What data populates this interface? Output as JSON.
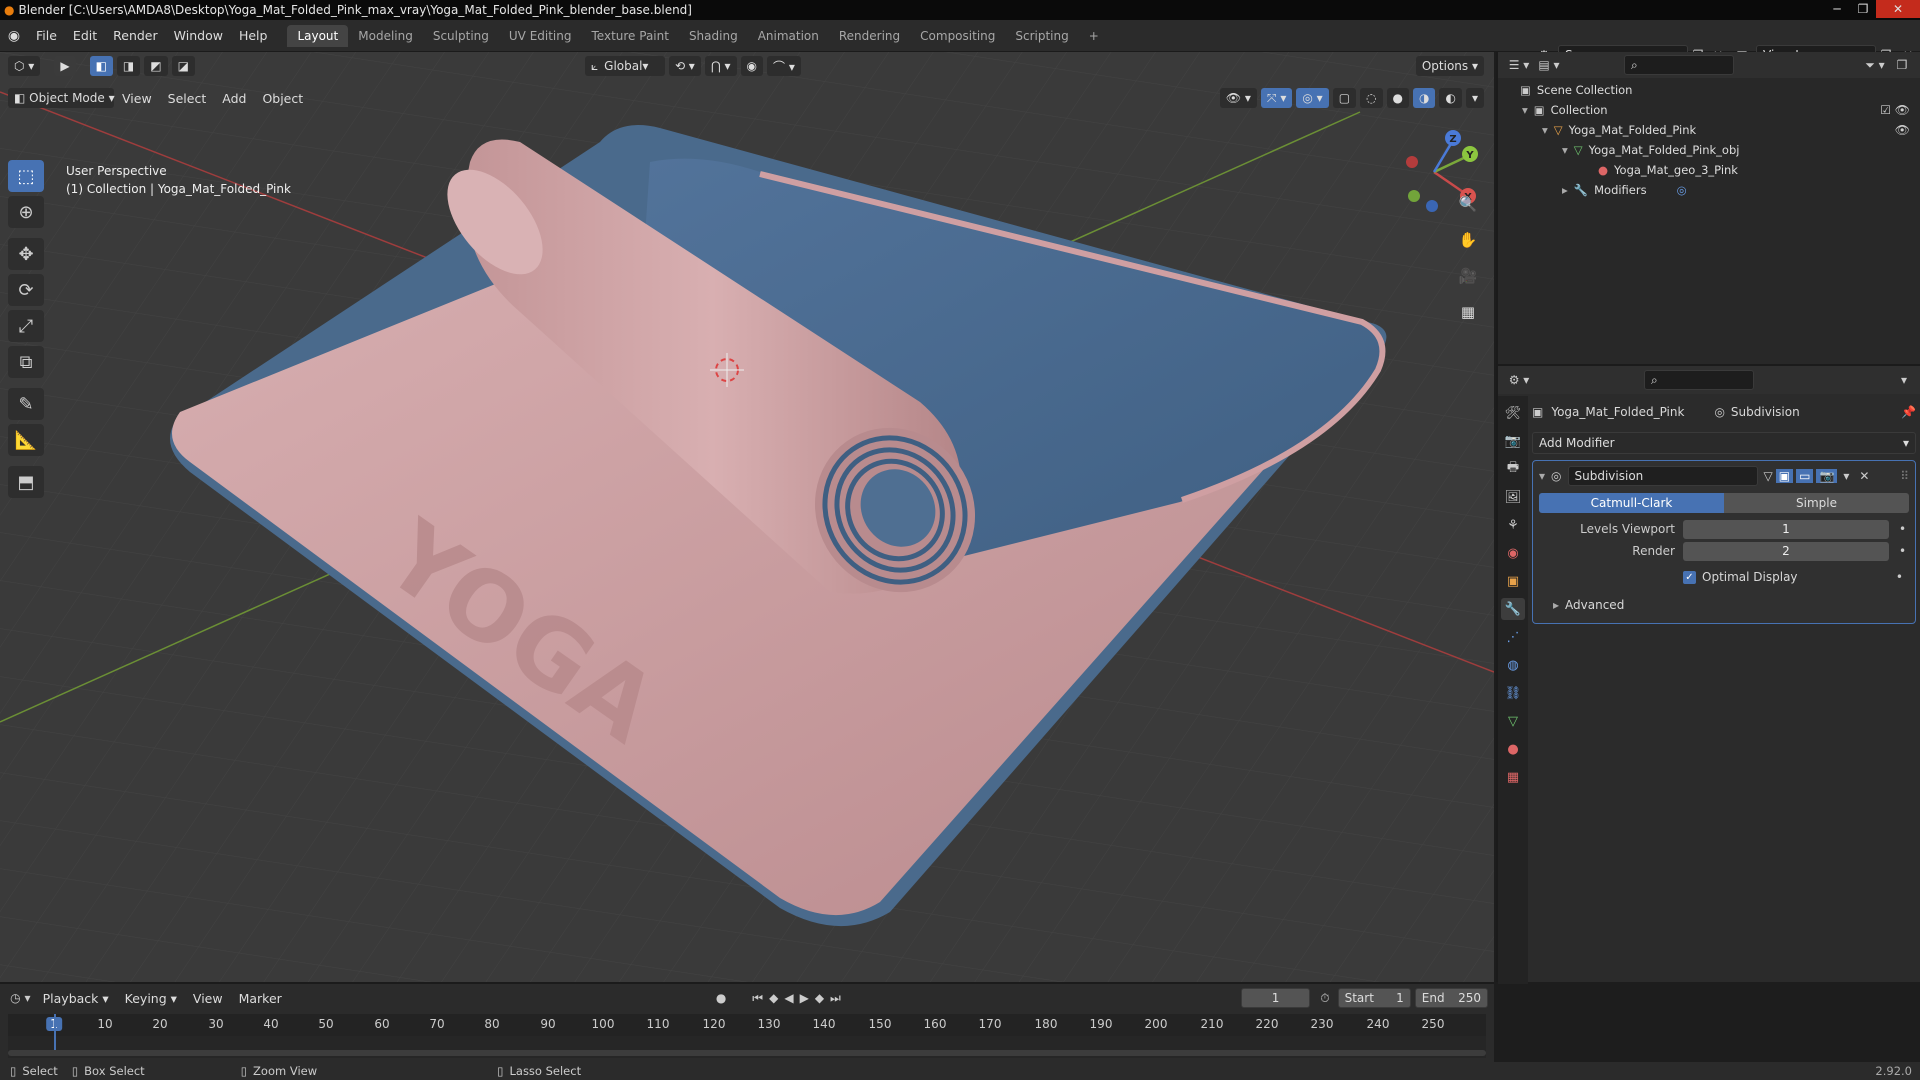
{
  "window": {
    "title": "Blender [C:\\Users\\AMDA8\\Desktop\\Yoga_Mat_Folded_Pink_max_vray\\Yoga_Mat_Folded_Pink_blender_base.blend]"
  },
  "menu": [
    "File",
    "Edit",
    "Render",
    "Window",
    "Help"
  ],
  "workspaces": [
    "Layout",
    "Modeling",
    "Sculpting",
    "UV Editing",
    "Texture Paint",
    "Shading",
    "Animation",
    "Rendering",
    "Compositing",
    "Scripting"
  ],
  "active_workspace": "Layout",
  "scene": {
    "name": "Scene",
    "view_layer": "View Layer"
  },
  "viewport": {
    "mode": "Object Mode",
    "menus": [
      "View",
      "Select",
      "Add",
      "Object"
    ],
    "transform_orientation": "Global",
    "options_label": "Options",
    "overlay_line1": "User Perspective",
    "overlay_line2": "(1) Collection | Yoga_Mat_Folded_Pink",
    "mat_text": "YOGA",
    "gizmo_axes": {
      "x": "X",
      "y": "Y",
      "z": "Z"
    }
  },
  "outliner": {
    "rows": [
      {
        "label": "Scene Collection"
      },
      {
        "label": "Collection"
      },
      {
        "label": "Yoga_Mat_Folded_Pink"
      },
      {
        "label": "Yoga_Mat_Folded_Pink_obj"
      },
      {
        "label": "Yoga_Mat_geo_3_Pink"
      },
      {
        "label": "Modifiers"
      }
    ]
  },
  "properties": {
    "object_name": "Yoga_Mat_Folded_Pink",
    "modifier_tab": "Subdivision",
    "add_modifier": "Add Modifier",
    "modifier": {
      "name": "Subdivision",
      "type_options": [
        "Catmull-Clark",
        "Simple"
      ],
      "active_type": "Catmull-Clark",
      "levels_viewport_label": "Levels Viewport",
      "levels_viewport": "1",
      "render_label": "Render",
      "render": "2",
      "optimal_display_label": "Optimal Display",
      "optimal_display": true,
      "advanced_label": "Advanced"
    }
  },
  "timeline": {
    "menus": [
      "Playback",
      "Keying",
      "View",
      "Marker"
    ],
    "current_frame": "1",
    "start_label": "Start",
    "start": "1",
    "end_label": "End",
    "end": "250",
    "ticks": [
      "1",
      "10",
      "20",
      "30",
      "40",
      "50",
      "60",
      "70",
      "80",
      "90",
      "100",
      "110",
      "120",
      "130",
      "140",
      "150",
      "160",
      "170",
      "180",
      "190",
      "200",
      "210",
      "220",
      "230",
      "240",
      "250"
    ]
  },
  "statusbar": {
    "select": "Select",
    "box_select": "Box Select",
    "zoom_view": "Zoom View",
    "lasso_select": "Lasso Select",
    "version": "2.92.0"
  },
  "colors": {
    "accent": "#4772b3",
    "mat_pink": "#c99a9c",
    "mat_blue": "#4a6a8c",
    "x_axis": "#c84a4a",
    "y_axis": "#7aa83a",
    "z_axis": "#4a7ad8"
  }
}
